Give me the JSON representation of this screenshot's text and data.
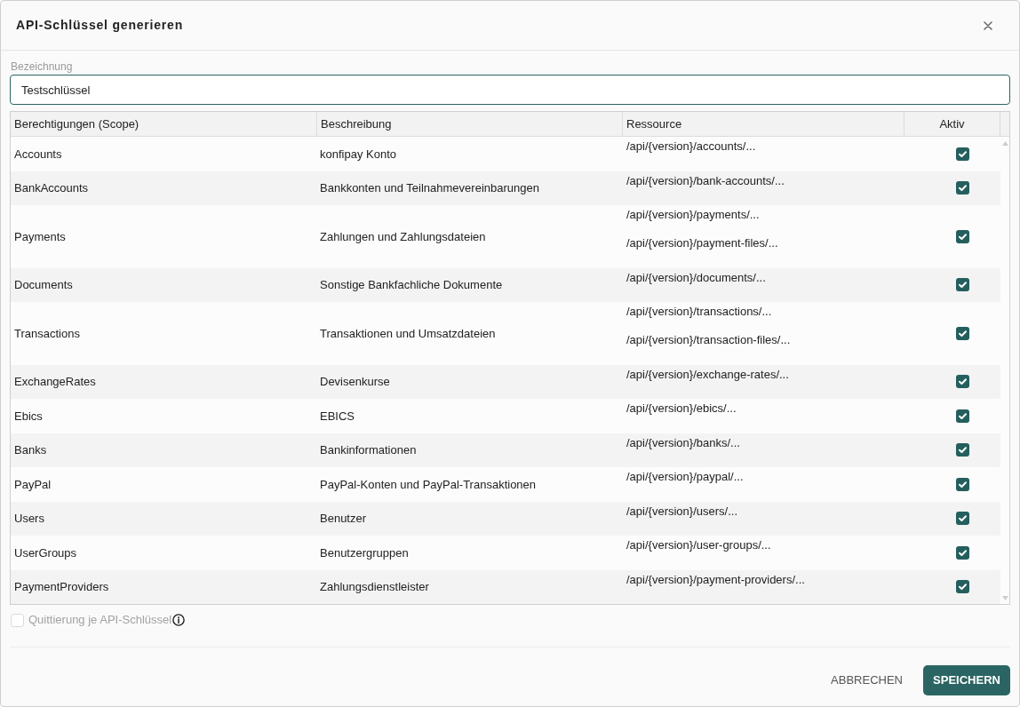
{
  "dialog": {
    "title": "API-Schlüssel generieren"
  },
  "name_field": {
    "label": "Bezeichnung",
    "value": "Testschlüssel",
    "focused": true
  },
  "table": {
    "columns": [
      "Berechtigungen (Scope)",
      "Beschreibung",
      "Ressource",
      "Aktiv"
    ],
    "rows": [
      {
        "scope": "Accounts",
        "description": "konfipay Konto",
        "resources": [
          "/api/{version}/accounts/..."
        ],
        "active": true
      },
      {
        "scope": "BankAccounts",
        "description": "Bankkonten und Teilnahmevereinbarungen",
        "resources": [
          "/api/{version}/bank-accounts/..."
        ],
        "active": true
      },
      {
        "scope": "Payments",
        "description": "Zahlungen und Zahlungsdateien",
        "resources": [
          "/api/{version}/payments/...",
          "/api/{version}/payment-files/..."
        ],
        "active": true
      },
      {
        "scope": "Documents",
        "description": "Sonstige Bankfachliche Dokumente",
        "resources": [
          "/api/{version}/documents/..."
        ],
        "active": true
      },
      {
        "scope": "Transactions",
        "description": "Transaktionen und Umsatzdateien",
        "resources": [
          "/api/{version}/transactions/...",
          "/api/{version}/transaction-files/..."
        ],
        "active": true
      },
      {
        "scope": "ExchangeRates",
        "description": "Devisenkurse",
        "resources": [
          "/api/{version}/exchange-rates/..."
        ],
        "active": true
      },
      {
        "scope": "Ebics",
        "description": "EBICS",
        "resources": [
          "/api/{version}/ebics/..."
        ],
        "active": true
      },
      {
        "scope": "Banks",
        "description": "Bankinformationen",
        "resources": [
          "/api/{version}/banks/..."
        ],
        "active": true
      },
      {
        "scope": "PayPal",
        "description": "PayPal-Konten und PayPal-Transaktionen",
        "resources": [
          "/api/{version}/paypal/..."
        ],
        "active": true
      },
      {
        "scope": "Users",
        "description": "Benutzer",
        "resources": [
          "/api/{version}/users/..."
        ],
        "active": true
      },
      {
        "scope": "UserGroups",
        "description": "Benutzergruppen",
        "resources": [
          "/api/{version}/user-groups/..."
        ],
        "active": true
      },
      {
        "scope": "PaymentProviders",
        "description": "Zahlungsdienstleister",
        "resources": [
          "/api/{version}/payment-providers/..."
        ],
        "active": true
      }
    ]
  },
  "acknowledgement": {
    "label": "Quittierung je API-Schlüssel",
    "checked": false,
    "disabled": true
  },
  "buttons": [
    {
      "label": "ABBRECHEN",
      "kind": "text"
    },
    {
      "label": "SPEICHERN",
      "kind": "primary"
    }
  ]
}
